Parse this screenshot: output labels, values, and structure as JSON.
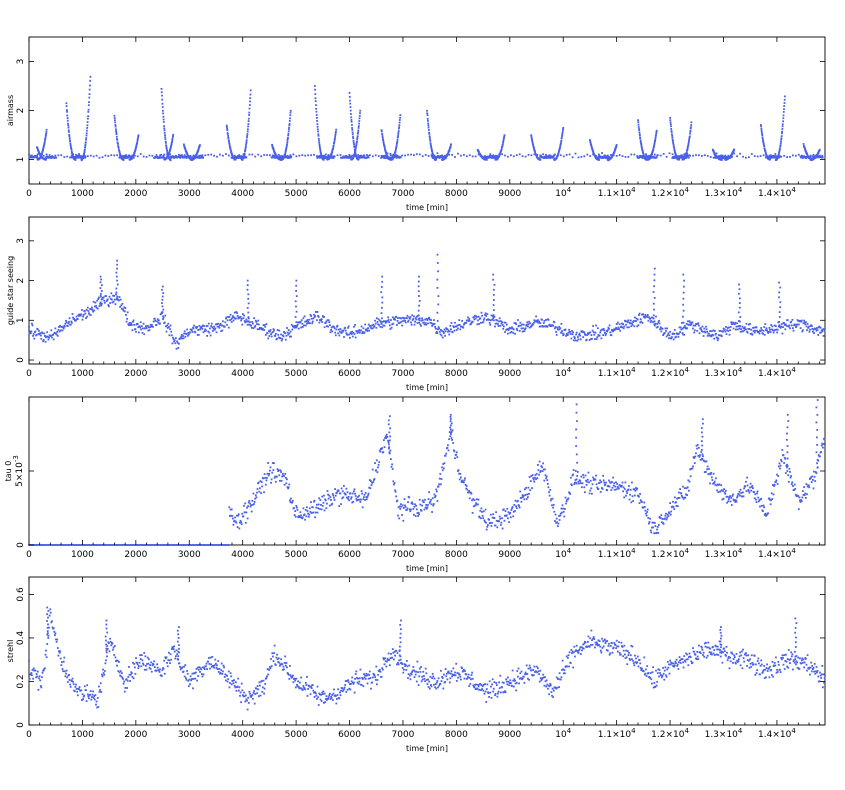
{
  "colors": {
    "points": "#4a60e8",
    "axes": "#000000",
    "background": "#ffffff"
  },
  "chart_data": [
    {
      "type": "scatter",
      "xlabel": "time [min]",
      "ylabel": "airmass",
      "xlim": [
        0,
        14900
      ],
      "ylim": [
        0.5,
        3.5
      ],
      "x_ticks": [
        0,
        1000,
        2000,
        3000,
        4000,
        5000,
        6000,
        7000,
        8000,
        9000,
        10000,
        11000,
        12000,
        13000,
        14000
      ],
      "x_tick_labels": [
        "0",
        "1000",
        "2000",
        "3000",
        "4000",
        "5000",
        "6000",
        "7000",
        "8000",
        "9000",
        "10^4",
        "1.1×10^4",
        "1.2×10^4",
        "1.3×10^4",
        "1.4×10^4"
      ],
      "y_ticks": [
        1,
        2,
        3
      ],
      "y_tick_labels": [
        "1",
        "2",
        "3"
      ],
      "pattern": "nightly airmass arcs starting/ending near 1.0–1.9 with peaks up to ~2.7",
      "peaks": [
        {
          "x": 150,
          "y": 1.25
        },
        {
          "x": 330,
          "y": 1.6
        },
        {
          "x": 700,
          "y": 2.15
        },
        {
          "x": 1150,
          "y": 2.7
        },
        {
          "x": 1600,
          "y": 1.9
        },
        {
          "x": 2050,
          "y": 1.5
        },
        {
          "x": 2480,
          "y": 2.45
        },
        {
          "x": 2700,
          "y": 1.5
        },
        {
          "x": 2900,
          "y": 1.3
        },
        {
          "x": 3200,
          "y": 1.3
        },
        {
          "x": 3700,
          "y": 1.7
        },
        {
          "x": 4150,
          "y": 2.4
        },
        {
          "x": 4550,
          "y": 1.3
        },
        {
          "x": 4900,
          "y": 2.0
        },
        {
          "x": 5350,
          "y": 2.5
        },
        {
          "x": 5750,
          "y": 1.6
        },
        {
          "x": 6000,
          "y": 2.35
        },
        {
          "x": 6200,
          "y": 2.0
        },
        {
          "x": 6600,
          "y": 1.6
        },
        {
          "x": 6950,
          "y": 1.9
        },
        {
          "x": 7450,
          "y": 2.0
        },
        {
          "x": 7900,
          "y": 1.3
        },
        {
          "x": 8400,
          "y": 1.2
        },
        {
          "x": 8900,
          "y": 1.5
        },
        {
          "x": 9400,
          "y": 1.5
        },
        {
          "x": 10000,
          "y": 1.65
        },
        {
          "x": 10500,
          "y": 1.4
        },
        {
          "x": 11000,
          "y": 1.3
        },
        {
          "x": 11400,
          "y": 1.8
        },
        {
          "x": 11750,
          "y": 1.6
        },
        {
          "x": 12000,
          "y": 1.85
        },
        {
          "x": 12400,
          "y": 1.75
        },
        {
          "x": 12800,
          "y": 1.2
        },
        {
          "x": 13200,
          "y": 1.2
        },
        {
          "x": 13700,
          "y": 1.7
        },
        {
          "x": 14150,
          "y": 2.3
        },
        {
          "x": 14500,
          "y": 1.3
        },
        {
          "x": 14800,
          "y": 1.2
        }
      ]
    },
    {
      "type": "scatter",
      "xlabel": "time [min]",
      "ylabel": "guide star seeing",
      "xlim": [
        0,
        14900
      ],
      "ylim": [
        -0.1,
        3.6
      ],
      "x_ticks": [
        0,
        1000,
        2000,
        3000,
        4000,
        5000,
        6000,
        7000,
        8000,
        9000,
        10000,
        11000,
        12000,
        13000,
        14000
      ],
      "x_tick_labels": [
        "0",
        "1000",
        "2000",
        "3000",
        "4000",
        "5000",
        "6000",
        "7000",
        "8000",
        "9000",
        "10^4",
        "1.1×10^4",
        "1.2×10^4",
        "1.3×10^4",
        "1.4×10^4"
      ],
      "y_ticks": [
        0,
        1,
        2,
        3
      ],
      "y_tick_labels": [
        "0",
        "1",
        "2",
        "3"
      ],
      "trend": [
        {
          "x": 0,
          "y": 0.75
        },
        {
          "x": 400,
          "y": 0.55
        },
        {
          "x": 800,
          "y": 1.0
        },
        {
          "x": 1100,
          "y": 1.2
        },
        {
          "x": 1400,
          "y": 1.5
        },
        {
          "x": 1650,
          "y": 1.6
        },
        {
          "x": 1900,
          "y": 0.9
        },
        {
          "x": 2200,
          "y": 0.8
        },
        {
          "x": 2500,
          "y": 1.1
        },
        {
          "x": 2750,
          "y": 0.4
        },
        {
          "x": 3000,
          "y": 0.75
        },
        {
          "x": 3500,
          "y": 0.8
        },
        {
          "x": 3900,
          "y": 1.1
        },
        {
          "x": 4200,
          "y": 0.9
        },
        {
          "x": 4700,
          "y": 0.6
        },
        {
          "x": 5100,
          "y": 0.9
        },
        {
          "x": 5400,
          "y": 1.1
        },
        {
          "x": 5700,
          "y": 0.8
        },
        {
          "x": 6000,
          "y": 0.65
        },
        {
          "x": 6500,
          "y": 0.9
        },
        {
          "x": 7000,
          "y": 1.0
        },
        {
          "x": 7500,
          "y": 1.0
        },
        {
          "x": 7700,
          "y": 0.7
        },
        {
          "x": 8100,
          "y": 0.9
        },
        {
          "x": 8500,
          "y": 1.1
        },
        {
          "x": 8700,
          "y": 1.0
        },
        {
          "x": 9000,
          "y": 0.75
        },
        {
          "x": 9500,
          "y": 0.95
        },
        {
          "x": 9800,
          "y": 0.85
        },
        {
          "x": 10300,
          "y": 0.6
        },
        {
          "x": 10800,
          "y": 0.7
        },
        {
          "x": 11200,
          "y": 0.9
        },
        {
          "x": 11600,
          "y": 1.1
        },
        {
          "x": 12000,
          "y": 0.6
        },
        {
          "x": 12400,
          "y": 0.9
        },
        {
          "x": 12900,
          "y": 0.6
        },
        {
          "x": 13200,
          "y": 0.9
        },
        {
          "x": 13600,
          "y": 0.7
        },
        {
          "x": 14100,
          "y": 0.85
        },
        {
          "x": 14500,
          "y": 0.9
        },
        {
          "x": 14900,
          "y": 0.7
        }
      ],
      "spread": 0.18,
      "spikes": [
        {
          "x": 1650,
          "y": 2.5
        },
        {
          "x": 1350,
          "y": 2.1
        },
        {
          "x": 2500,
          "y": 1.85
        },
        {
          "x": 4100,
          "y": 2.0
        },
        {
          "x": 5000,
          "y": 2.0
        },
        {
          "x": 6600,
          "y": 2.1
        },
        {
          "x": 7650,
          "y": 2.65
        },
        {
          "x": 7300,
          "y": 2.1
        },
        {
          "x": 8700,
          "y": 2.15
        },
        {
          "x": 11700,
          "y": 2.3
        },
        {
          "x": 12250,
          "y": 2.15
        },
        {
          "x": 13300,
          "y": 1.9
        },
        {
          "x": 14050,
          "y": 1.95
        }
      ]
    },
    {
      "type": "scatter",
      "xlabel": "time [min]",
      "ylabel": "tau 0",
      "ylabel2": "5×10^-3",
      "xlim": [
        0,
        14900
      ],
      "ylim": [
        0,
        0.01
      ],
      "x_ticks": [
        0,
        1000,
        2000,
        3000,
        4000,
        5000,
        6000,
        7000,
        8000,
        9000,
        10000,
        11000,
        12000,
        13000,
        14000
      ],
      "x_tick_labels": [
        "0",
        "1000",
        "2000",
        "3000",
        "4000",
        "5000",
        "6000",
        "7000",
        "8000",
        "9000",
        "10^4",
        "1.1×10^4",
        "1.2×10^4",
        "1.3×10^4",
        "1.4×10^4"
      ],
      "y_ticks": [
        0,
        0.005
      ],
      "y_tick_labels": [
        "0",
        "5×10^-3"
      ],
      "zero_until_x": 3750,
      "trend": [
        {
          "x": 3750,
          "y": 0.0025
        },
        {
          "x": 3900,
          "y": 0.0015
        },
        {
          "x": 4200,
          "y": 0.003
        },
        {
          "x": 4500,
          "y": 0.005
        },
        {
          "x": 4800,
          "y": 0.0045
        },
        {
          "x": 5000,
          "y": 0.002
        },
        {
          "x": 5400,
          "y": 0.0025
        },
        {
          "x": 5800,
          "y": 0.0035
        },
        {
          "x": 6300,
          "y": 0.003
        },
        {
          "x": 6700,
          "y": 0.0075
        },
        {
          "x": 6900,
          "y": 0.0025
        },
        {
          "x": 7300,
          "y": 0.0025
        },
        {
          "x": 7600,
          "y": 0.003
        },
        {
          "x": 7900,
          "y": 0.0075
        },
        {
          "x": 8100,
          "y": 0.0045
        },
        {
          "x": 8300,
          "y": 0.003
        },
        {
          "x": 8600,
          "y": 0.0015
        },
        {
          "x": 9000,
          "y": 0.002
        },
        {
          "x": 9300,
          "y": 0.0035
        },
        {
          "x": 9600,
          "y": 0.0055
        },
        {
          "x": 9900,
          "y": 0.0015
        },
        {
          "x": 10200,
          "y": 0.0045
        },
        {
          "x": 10600,
          "y": 0.004
        },
        {
          "x": 11000,
          "y": 0.004
        },
        {
          "x": 11400,
          "y": 0.0035
        },
        {
          "x": 11700,
          "y": 0.001
        },
        {
          "x": 12000,
          "y": 0.0025
        },
        {
          "x": 12300,
          "y": 0.0035
        },
        {
          "x": 12500,
          "y": 0.0065
        },
        {
          "x": 12800,
          "y": 0.0045
        },
        {
          "x": 13100,
          "y": 0.003
        },
        {
          "x": 13500,
          "y": 0.004
        },
        {
          "x": 13800,
          "y": 0.002
        },
        {
          "x": 14100,
          "y": 0.006
        },
        {
          "x": 14400,
          "y": 0.003
        },
        {
          "x": 14700,
          "y": 0.0045
        },
        {
          "x": 14900,
          "y": 0.0075
        }
      ],
      "spread": 0.0007,
      "spikes": [
        {
          "x": 6750,
          "y": 0.0087
        },
        {
          "x": 7900,
          "y": 0.0088
        },
        {
          "x": 10250,
          "y": 0.0095
        },
        {
          "x": 12600,
          "y": 0.0085
        },
        {
          "x": 14200,
          "y": 0.0088
        },
        {
          "x": 14750,
          "y": 0.0098
        }
      ]
    },
    {
      "type": "scatter",
      "xlabel": "time [min]",
      "ylabel": "strehl",
      "xlim": [
        0,
        14900
      ],
      "ylim": [
        0,
        0.68
      ],
      "x_ticks": [
        0,
        1000,
        2000,
        3000,
        4000,
        5000,
        6000,
        7000,
        8000,
        9000,
        10000,
        11000,
        12000,
        13000,
        14000
      ],
      "x_tick_labels": [
        "0",
        "1000",
        "2000",
        "3000",
        "4000",
        "5000",
        "6000",
        "7000",
        "8000",
        "9000",
        "10^4",
        "1.1×10^4",
        "1.2×10^4",
        "1.3×10^4",
        "1.4×10^4"
      ],
      "y_ticks": [
        0,
        0.2,
        0.4,
        0.6
      ],
      "y_tick_labels": [
        "0",
        "0.2",
        "0.4",
        "0.6"
      ],
      "trend": [
        {
          "x": 0,
          "y": 0.25
        },
        {
          "x": 250,
          "y": 0.2
        },
        {
          "x": 400,
          "y": 0.5
        },
        {
          "x": 600,
          "y": 0.3
        },
        {
          "x": 900,
          "y": 0.15
        },
        {
          "x": 1300,
          "y": 0.12
        },
        {
          "x": 1500,
          "y": 0.38
        },
        {
          "x": 1800,
          "y": 0.2
        },
        {
          "x": 2100,
          "y": 0.3
        },
        {
          "x": 2500,
          "y": 0.25
        },
        {
          "x": 2700,
          "y": 0.35
        },
        {
          "x": 3000,
          "y": 0.2
        },
        {
          "x": 3400,
          "y": 0.3
        },
        {
          "x": 3800,
          "y": 0.2
        },
        {
          "x": 4100,
          "y": 0.12
        },
        {
          "x": 4400,
          "y": 0.18
        },
        {
          "x": 4600,
          "y": 0.33
        },
        {
          "x": 5000,
          "y": 0.2
        },
        {
          "x": 5500,
          "y": 0.12
        },
        {
          "x": 5800,
          "y": 0.15
        },
        {
          "x": 6100,
          "y": 0.2
        },
        {
          "x": 6500,
          "y": 0.22
        },
        {
          "x": 6800,
          "y": 0.35
        },
        {
          "x": 7100,
          "y": 0.25
        },
        {
          "x": 7600,
          "y": 0.2
        },
        {
          "x": 8000,
          "y": 0.25
        },
        {
          "x": 8600,
          "y": 0.15
        },
        {
          "x": 9000,
          "y": 0.2
        },
        {
          "x": 9500,
          "y": 0.25
        },
        {
          "x": 9800,
          "y": 0.15
        },
        {
          "x": 10200,
          "y": 0.33
        },
        {
          "x": 10500,
          "y": 0.38
        },
        {
          "x": 11000,
          "y": 0.35
        },
        {
          "x": 11400,
          "y": 0.3
        },
        {
          "x": 11700,
          "y": 0.2
        },
        {
          "x": 11900,
          "y": 0.25
        },
        {
          "x": 12300,
          "y": 0.3
        },
        {
          "x": 12700,
          "y": 0.35
        },
        {
          "x": 13100,
          "y": 0.32
        },
        {
          "x": 13500,
          "y": 0.3
        },
        {
          "x": 13800,
          "y": 0.25
        },
        {
          "x": 14200,
          "y": 0.3
        },
        {
          "x": 14600,
          "y": 0.28
        },
        {
          "x": 14900,
          "y": 0.2
        }
      ],
      "spread": 0.05,
      "spikes": [
        {
          "x": 350,
          "y": 0.54
        },
        {
          "x": 1450,
          "y": 0.48
        },
        {
          "x": 2800,
          "y": 0.45
        },
        {
          "x": 6950,
          "y": 0.48
        },
        {
          "x": 12950,
          "y": 0.45
        },
        {
          "x": 14350,
          "y": 0.49
        }
      ]
    }
  ]
}
